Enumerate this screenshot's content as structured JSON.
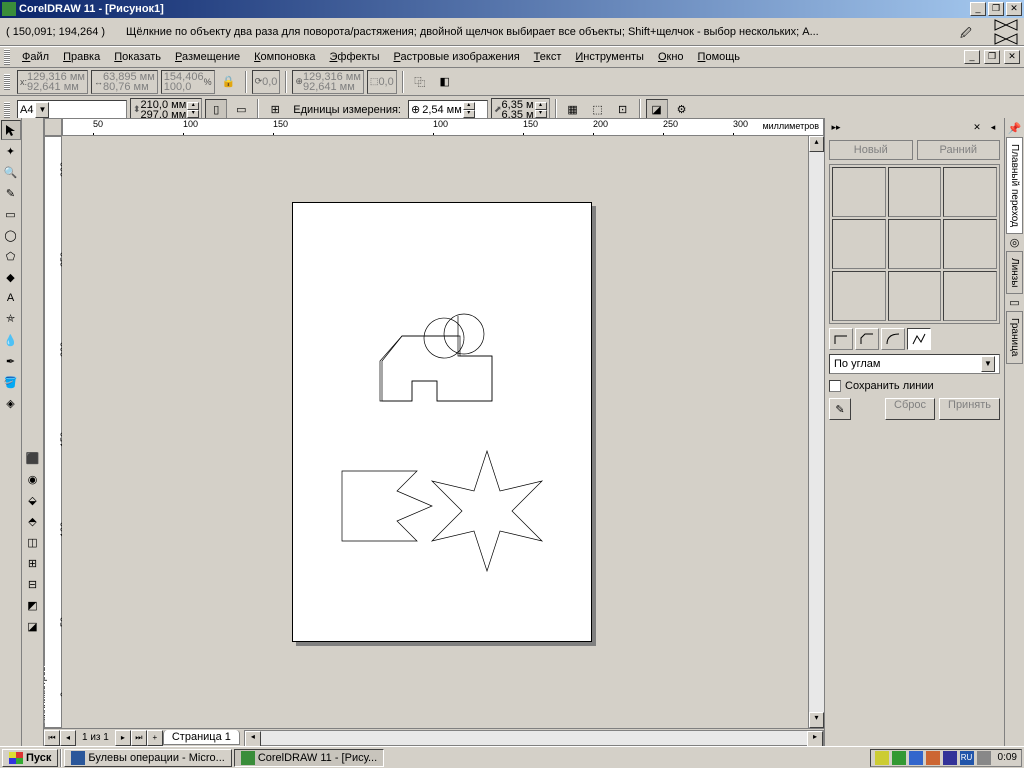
{
  "title": "CorelDRAW 11 - [Рисунок1]",
  "coords": "( 150,091; 194,264 )",
  "hint": "Щёлкние по объекту два раза для поворота/растяжения; двойной щелчок выбирает все объекты; Shift+щелчок - выбор нескольких; A...",
  "menu": [
    "Файл",
    "Правка",
    "Показать",
    "Размещение",
    "Компоновка",
    "Эффекты",
    "Растровые изображения",
    "Текст",
    "Инструменты",
    "Окно",
    "Помощь"
  ],
  "prop1": {
    "x": "129,316 мм",
    "y": "92,641 мм",
    "w": "63,895 мм",
    "h": "80,76 мм",
    "sx": "154,406",
    "sy": "100,0",
    "rot": "0,0",
    "cx": "129,316 мм",
    "cy": "92,641 мм",
    "sk": "0,0"
  },
  "prop2": {
    "paper": "A4",
    "pw": "210,0 мм",
    "ph": "297,0 мм",
    "units_label": "Единицы измерения:",
    "nudge": "2,54 мм",
    "dup_x": "6,35 м",
    "dup_y": "6,35 м"
  },
  "ruler_h": [
    "50",
    "100",
    "150",
    "100",
    "150",
    "200",
    "250",
    "300"
  ],
  "ruler_h_unit": "миллиметров",
  "ruler_v": [
    "300",
    "250",
    "200",
    "150",
    "100",
    "50",
    "0"
  ],
  "ruler_v_unit": "миллиметров",
  "page_counter": "1 из 1",
  "page_tab": "Страница 1",
  "docker": {
    "new": "Новый",
    "early": "Ранний",
    "dd": "По углам",
    "keep_lines": "Сохранить линии",
    "reset": "Сброс",
    "apply": "Принять",
    "tabs": [
      "Плавный переход",
      "Линзы",
      "Граница"
    ]
  },
  "taskbar": {
    "start": "Пуск",
    "tasks": [
      {
        "label": "Булевы операции - Micro...",
        "active": false
      },
      {
        "label": "CorelDRAW 11 - [Рису...",
        "active": true
      }
    ],
    "lang": "RU",
    "clock": "0:09"
  }
}
